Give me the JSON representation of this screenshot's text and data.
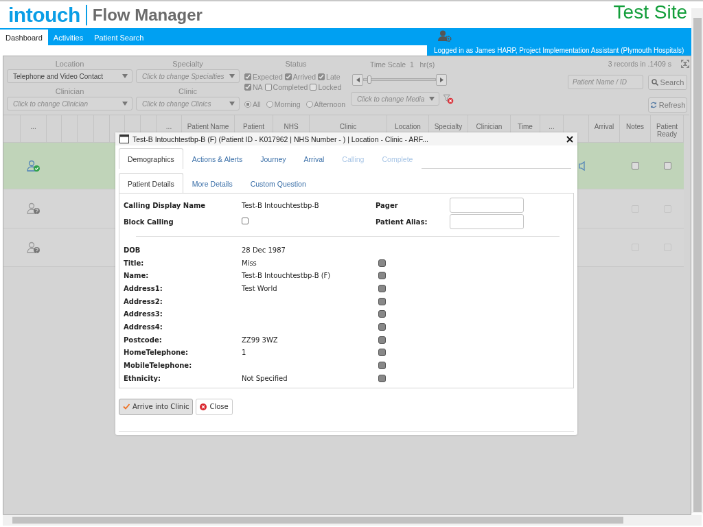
{
  "header": {
    "logo": "intouch",
    "product": "Flow Manager",
    "site": "Test Site"
  },
  "nav": {
    "tabs": [
      {
        "label": "Dashboard",
        "selected": true
      },
      {
        "label": "Activities",
        "selected": false
      },
      {
        "label": "Patient Search",
        "selected": false
      }
    ],
    "user": "Logged in as James HARP, Project Implementation Assistant (Plymouth Hospitals)"
  },
  "filters": {
    "location": {
      "label": "Location",
      "value": "Telephone and Video Contact"
    },
    "specialty": {
      "label": "Specialty",
      "placeholder": "Click to change Specialties"
    },
    "clinician": {
      "label": "Clinician",
      "placeholder": "Click to change Clinician"
    },
    "clinic": {
      "label": "Clinic",
      "placeholder": "Click to change Clinics"
    },
    "status": {
      "label": "Status",
      "options": [
        {
          "label": "Expected",
          "checked": true
        },
        {
          "label": "Arrived",
          "checked": true
        },
        {
          "label": "Late",
          "checked": true
        },
        {
          "label": "NA",
          "checked": true
        },
        {
          "label": "Completed",
          "checked": false
        },
        {
          "label": "Locked",
          "checked": false
        }
      ]
    },
    "session": [
      {
        "label": "All",
        "selected": true
      },
      {
        "label": "Morning",
        "selected": false
      },
      {
        "label": "Afternoon",
        "selected": false
      }
    ],
    "time_scale": {
      "label": "Time Scale",
      "value": "1",
      "unit": "hr(s)",
      "level": 0.05
    },
    "media": {
      "placeholder": "Click to change Media"
    },
    "records": "3 records in .1409 s",
    "search": {
      "placeholder": "Patient Name / ID",
      "button": "Search"
    },
    "refresh": "Refresh"
  },
  "table": {
    "columns": [
      {
        "kind": "blank"
      },
      {
        "kind": "text",
        "label": "..."
      },
      {
        "kind": "blank"
      },
      {
        "kind": "blank"
      },
      {
        "kind": "blank"
      },
      {
        "kind": "blank"
      },
      {
        "kind": "blank"
      },
      {
        "kind": "blank"
      },
      {
        "kind": "blank"
      },
      {
        "kind": "text",
        "label": "..."
      },
      {
        "kind": "text",
        "label": "Patient Name"
      },
      {
        "kind": "text",
        "label": "Patient"
      },
      {
        "kind": "text",
        "label": "NHS"
      },
      {
        "kind": "text",
        "label": "Clinic"
      },
      {
        "kind": "text",
        "label": "Location"
      },
      {
        "kind": "text",
        "label": "Specialty"
      },
      {
        "kind": "text",
        "label": "Clinician"
      },
      {
        "kind": "text",
        "label": "Time"
      },
      {
        "kind": "text",
        "label": "..."
      },
      {
        "kind": "blank"
      },
      {
        "kind": "text",
        "label": "Arrival"
      },
      {
        "kind": "text",
        "label": "Notes"
      },
      {
        "kind": "text",
        "label": "Patient Ready"
      }
    ],
    "rows": [
      {
        "kind": "arrived",
        "notes": false,
        "patient_ready": false,
        "disabled": false
      },
      {
        "kind": "unknown",
        "notes": false,
        "patient_ready": false,
        "disabled": true
      },
      {
        "kind": "unknown",
        "notes": false,
        "patient_ready": false,
        "disabled": true
      }
    ]
  },
  "dialog": {
    "title": "Test-B Intouchtestbp-B (F) (Patient ID - K017962 | NHS Number - ) | Location - Clinic - ARF...",
    "tabs": [
      {
        "label": "Demographics",
        "selected": true,
        "disabled": false
      },
      {
        "label": "Actions & Alerts",
        "selected": false,
        "disabled": false
      },
      {
        "label": "Journey",
        "selected": false,
        "disabled": false
      },
      {
        "label": "Arrival",
        "selected": false,
        "disabled": false
      },
      {
        "label": "Calling",
        "selected": false,
        "disabled": true
      },
      {
        "label": "Complete",
        "selected": false,
        "disabled": true
      }
    ],
    "subtabs": [
      {
        "label": "Patient Details",
        "selected": true
      },
      {
        "label": "More Details",
        "selected": false
      },
      {
        "label": "Custom Question",
        "selected": false
      }
    ],
    "calling_display_name": {
      "label": "Calling Display Name",
      "value": "Test-B Intouchtestbp-B"
    },
    "block_calling": {
      "label": "Block Calling",
      "checked": false
    },
    "pager": {
      "label": "Pager"
    },
    "patient_alias": {
      "label": "Patient Alias:"
    },
    "fields": [
      {
        "label": "DOB",
        "value": "28 Dec 1987"
      },
      {
        "label": "Title:",
        "value": "Miss",
        "checked": false
      },
      {
        "label": "Name:",
        "value": "Test-B Intouchtestbp-B (F)",
        "checked": false
      },
      {
        "label": "Address1:",
        "value": "Test World",
        "checked": false
      },
      {
        "label": "Address2:",
        "checked": false
      },
      {
        "label": "Address3:",
        "checked": false
      },
      {
        "label": "Address4:",
        "checked": false
      },
      {
        "label": "Postcode:",
        "value": "ZZ99 3WZ",
        "checked": false
      },
      {
        "label": "HomeTelephone:",
        "value": "1",
        "checked": false
      },
      {
        "label": "MobileTelephone:",
        "checked": false
      },
      {
        "label": "Ethnicity:",
        "value": "Not Specified",
        "checked": false
      }
    ],
    "buttons": [
      {
        "kind": "arrive",
        "label": "Arrive into Clinic"
      },
      {
        "kind": "close",
        "label": "Close"
      }
    ]
  }
}
